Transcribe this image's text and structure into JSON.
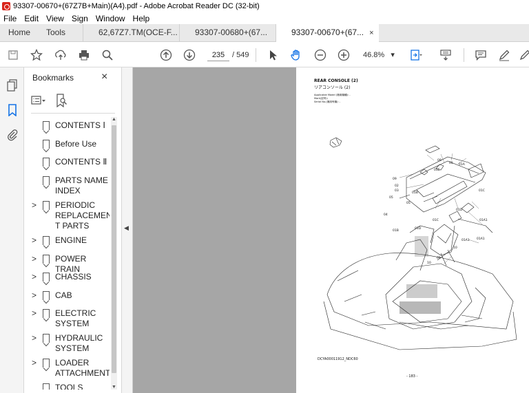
{
  "window": {
    "title": "93307-00670+(67Z7B+Main)(A4).pdf - Adobe Acrobat Reader DC (32-bit)"
  },
  "menu": [
    "File",
    "Edit",
    "View",
    "Sign",
    "Window",
    "Help"
  ],
  "tabs": {
    "home": "Home",
    "tools": "Tools",
    "docs": [
      "62,67Z7.TM(OCE-F...",
      "93307-00680+(67...",
      "93307-00670+(67..."
    ],
    "close": "×"
  },
  "toolbar": {
    "page_current": "235",
    "page_total": "/ 549",
    "zoom": "46.8%",
    "zoom_caret": "▾"
  },
  "bookmarks": {
    "header": "Bookmarks",
    "close": "×",
    "items": [
      {
        "label": "CONTENTS Ⅰ",
        "expandable": false
      },
      {
        "label": "Before Use",
        "expandable": false
      },
      {
        "label": "CONTENTS Ⅱ",
        "expandable": false
      },
      {
        "label": "PARTS NAME INDEX",
        "expandable": false
      },
      {
        "label": "PERIODIC REPLACEMEN T PARTS",
        "expandable": true
      },
      {
        "label": "ENGINE",
        "expandable": true
      },
      {
        "label": "POWER TRAIN",
        "expandable": true
      },
      {
        "label": "CHASSIS",
        "expandable": true
      },
      {
        "label": "CAB",
        "expandable": true
      },
      {
        "label": "ELECTRIC SYSTEM",
        "expandable": true
      },
      {
        "label": "HYDRAULIC SYSTEM",
        "expandable": true
      },
      {
        "label": "LOADER ATTACHMENT",
        "expandable": true
      },
      {
        "label": "TOOLS",
        "expandable": false
      }
    ]
  },
  "page": {
    "title_en": "REAR CONSOLE (2)",
    "title_jp": "リアコンソール (2)",
    "meta1": "Applicable Model (適用機種): -",
    "meta2": "Mark(記号):",
    "meta3": "Serial No.(適用号機): -",
    "figure_id": "DCYA00011912_NDC60",
    "page_number": "- 183 -",
    "callouts": [
      "09",
      "05",
      "01A",
      "01E",
      "09",
      "02",
      "03",
      "05",
      "01B",
      "05",
      "04",
      "01B",
      "01D",
      "01C",
      "01C",
      "01D",
      "01A1",
      "01A1",
      "01A1",
      "10",
      "10",
      "09"
    ]
  },
  "colors": {
    "accent": "#d9261c",
    "hand_tool": "#1473e6",
    "doc_bg": "#a6a6a6"
  }
}
